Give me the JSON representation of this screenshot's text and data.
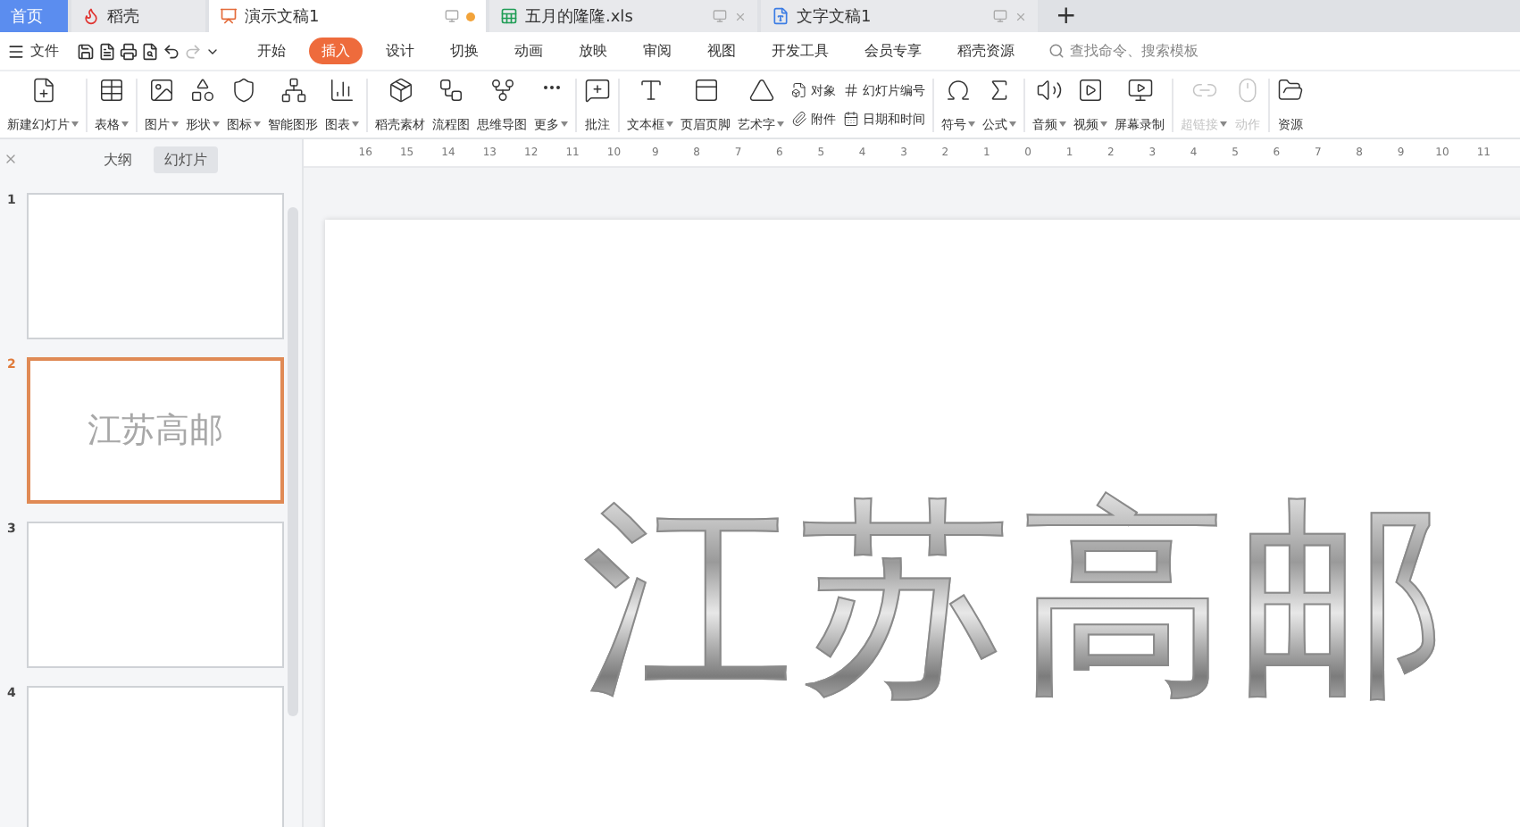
{
  "window_tabs": [
    {
      "label": "首页",
      "kind": "home",
      "selected": false
    },
    {
      "label": "稻壳",
      "kind": "docer",
      "selected": false
    },
    {
      "label": "演示文稿1",
      "kind": "ppt",
      "selected": true
    },
    {
      "label": "五月的隆隆.xls",
      "kind": "xls",
      "selected": false
    },
    {
      "label": "文字文稿1",
      "kind": "doc",
      "selected": false
    }
  ],
  "new_tab": "+",
  "file_menu": "文件",
  "menu_tabs": [
    {
      "label": "开始",
      "selected": false
    },
    {
      "label": "插入",
      "selected": true
    },
    {
      "label": "设计",
      "selected": false
    },
    {
      "label": "切换",
      "selected": false
    },
    {
      "label": "动画",
      "selected": false
    },
    {
      "label": "放映",
      "selected": false
    },
    {
      "label": "审阅",
      "selected": false
    },
    {
      "label": "视图",
      "selected": false
    },
    {
      "label": "开发工具",
      "selected": false
    },
    {
      "label": "会员专享",
      "selected": false
    },
    {
      "label": "稻壳资源",
      "selected": false
    }
  ],
  "search": {
    "placeholder": "查找命令、搜索模板"
  },
  "ribbon": [
    {
      "kind": "big",
      "label": "新建幻灯片",
      "dropdown": true,
      "disabled": false
    },
    {
      "kind": "sep"
    },
    {
      "kind": "big",
      "label": "表格",
      "dropdown": true,
      "disabled": false
    },
    {
      "kind": "sep"
    },
    {
      "kind": "big",
      "label": "图片",
      "dropdown": true,
      "disabled": false
    },
    {
      "kind": "big",
      "label": "形状",
      "dropdown": true,
      "disabled": false
    },
    {
      "kind": "big",
      "label": "图标",
      "dropdown": true,
      "disabled": false
    },
    {
      "kind": "big",
      "label": "智能图形",
      "dropdown": false,
      "disabled": false
    },
    {
      "kind": "big",
      "label": "图表",
      "dropdown": true,
      "disabled": false
    },
    {
      "kind": "sep"
    },
    {
      "kind": "big",
      "label": "稻壳素材",
      "dropdown": false,
      "disabled": false
    },
    {
      "kind": "big",
      "label": "流程图",
      "dropdown": false,
      "disabled": false
    },
    {
      "kind": "big",
      "label": "思维导图",
      "dropdown": false,
      "disabled": false
    },
    {
      "kind": "big",
      "label": "更多",
      "dropdown": true,
      "disabled": false
    },
    {
      "kind": "sep"
    },
    {
      "kind": "big",
      "label": "批注",
      "dropdown": false,
      "disabled": false
    },
    {
      "kind": "sep"
    },
    {
      "kind": "big",
      "label": "文本框",
      "dropdown": true,
      "disabled": false
    },
    {
      "kind": "big",
      "label": "页眉页脚",
      "dropdown": false,
      "disabled": false
    },
    {
      "kind": "big",
      "label": "艺术字",
      "dropdown": true,
      "disabled": false
    },
    {
      "kind": "pair",
      "items": [
        "对象",
        "附件"
      ]
    },
    {
      "kind": "pair",
      "items": [
        "幻灯片编号",
        "日期和时间"
      ]
    },
    {
      "kind": "sep"
    },
    {
      "kind": "big",
      "label": "符号",
      "dropdown": true,
      "disabled": false
    },
    {
      "kind": "big",
      "label": "公式",
      "dropdown": true,
      "disabled": false
    },
    {
      "kind": "sep"
    },
    {
      "kind": "big",
      "label": "音频",
      "dropdown": true,
      "disabled": false
    },
    {
      "kind": "big",
      "label": "视频",
      "dropdown": true,
      "disabled": false
    },
    {
      "kind": "big",
      "label": "屏幕录制",
      "dropdown": false,
      "disabled": false
    },
    {
      "kind": "sep"
    },
    {
      "kind": "big",
      "label": "超链接",
      "dropdown": true,
      "disabled": true
    },
    {
      "kind": "big",
      "label": "动作",
      "dropdown": false,
      "disabled": true
    },
    {
      "kind": "sep"
    },
    {
      "kind": "big",
      "label": "资源",
      "dropdown": false,
      "disabled": false
    }
  ],
  "pane_tabs": [
    {
      "label": "大纲",
      "selected": false
    },
    {
      "label": "幻灯片",
      "selected": true
    }
  ],
  "slides": [
    {
      "number": "1",
      "selected": false
    },
    {
      "number": "2",
      "selected": true,
      "title": "江苏高邮"
    },
    {
      "number": "3",
      "selected": false
    },
    {
      "number": "4",
      "selected": false
    }
  ],
  "ruler": [
    "16",
    "15",
    "14",
    "13",
    "12",
    "11",
    "10",
    "9",
    "8",
    "7",
    "6",
    "5",
    "4",
    "3",
    "2",
    "1",
    "0",
    "1",
    "2",
    "3",
    "4",
    "5",
    "6",
    "7",
    "8",
    "9",
    "10",
    "11"
  ],
  "slide": {
    "title": "江苏高邮"
  }
}
